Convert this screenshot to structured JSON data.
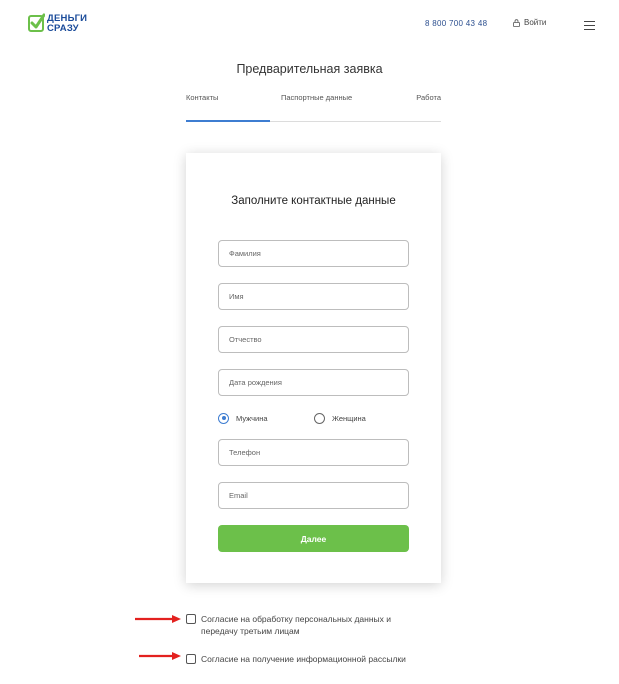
{
  "header": {
    "logo_line1": "ДЕНЬГИ",
    "logo_line2": "СРАЗУ",
    "phone": "8 800 700 43 48",
    "login_label": "Войти",
    "logo_green": "#6cc04a",
    "logo_blue": "#1a4b9a"
  },
  "page": {
    "title": "Предварительная заявка",
    "tabs": [
      "Контакты",
      "Паспортные данные",
      "Работа"
    ],
    "active_tab": 0
  },
  "form": {
    "title": "Заполните контактные данные",
    "fields": {
      "last_name_placeholder": "Фамилия",
      "first_name_placeholder": "Имя",
      "middle_name_placeholder": "Отчество",
      "birth_date_placeholder": "Дата рождения",
      "phone_placeholder": "Телефон",
      "email_placeholder": "Email"
    },
    "gender": {
      "options": [
        "Мужчина",
        "Женщина"
      ],
      "selected": "Мужчина"
    },
    "submit_label": "Далее",
    "accent_color": "#3e7dd1",
    "submit_color": "#6cc04a"
  },
  "consents": {
    "personal_data": "Согласие на обработку персональных данных и передачу третьим лицам",
    "newsletter": "Согласие на получение информационной рассылки",
    "annotation_arrow_color": "#e3211f"
  }
}
